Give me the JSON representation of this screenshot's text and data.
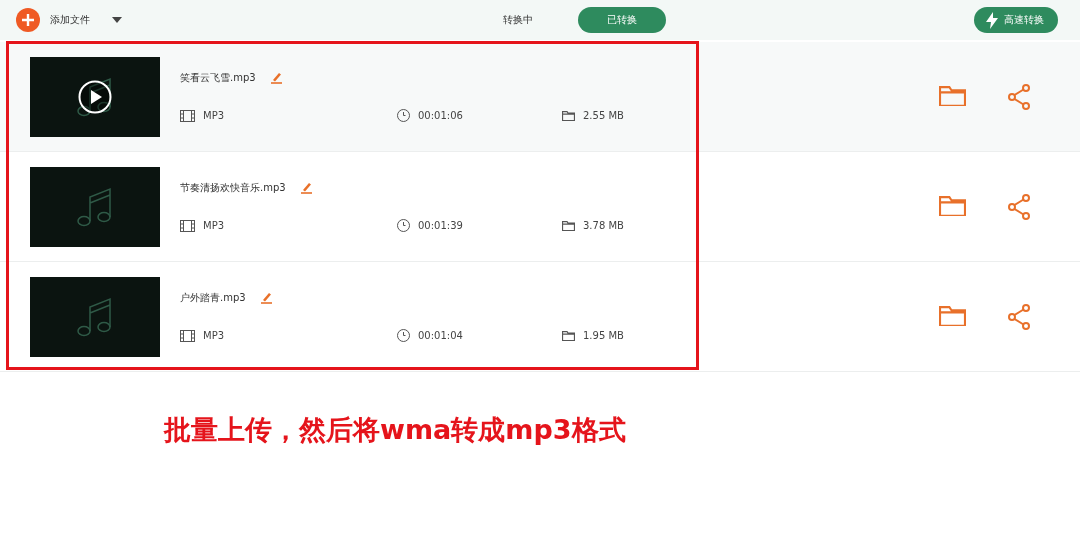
{
  "toolbar": {
    "add_label": "添加文件",
    "tabs": [
      {
        "label": "转换中",
        "selected": false
      },
      {
        "label": "已转换",
        "selected": true
      }
    ],
    "convert_button": "高速转换"
  },
  "files": [
    {
      "name": "笑看云飞雪.mp3",
      "format": "MP3",
      "duration": "00:01:06",
      "size": "2.55 MB",
      "hovered": true
    },
    {
      "name": "节奏清扬欢快音乐.mp3",
      "format": "MP3",
      "duration": "00:01:39",
      "size": "3.78 MB",
      "hovered": false
    },
    {
      "name": "户外踏青.mp3",
      "format": "MP3",
      "duration": "00:01:04",
      "size": "1.95 MB",
      "hovered": false
    }
  ],
  "caption": "批量上传，然后将wma转成mp3格式"
}
